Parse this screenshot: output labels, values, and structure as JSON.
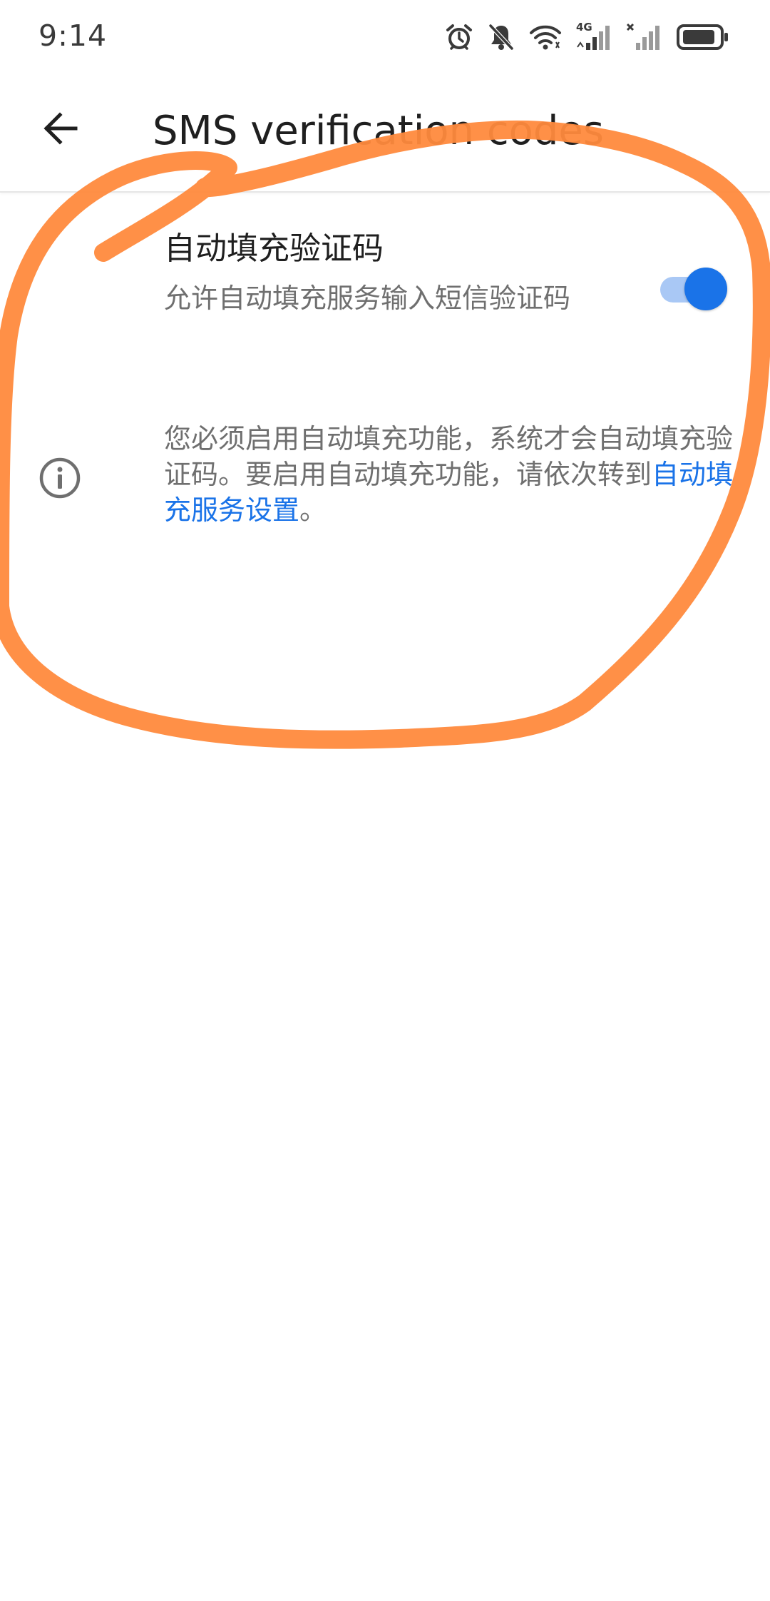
{
  "status_bar": {
    "time": "9:14",
    "network_label": "4G",
    "icons": [
      "alarm-icon",
      "bell-off-icon",
      "wifi-icon",
      "cellular-signal-icon",
      "no-sim-signal-icon",
      "battery-icon"
    ]
  },
  "app_bar": {
    "back_icon": "arrow-back-icon",
    "title": "SMS verification codes"
  },
  "switch_setting": {
    "title": "自动填充验证码",
    "summary": "允许自动填充服务输入短信验证码",
    "checked": true
  },
  "info": {
    "icon": "info-icon",
    "text_before_link": "您必须启用自动填充功能，系统才会自动填充验证码。要启用自动填充功能，请依次转到",
    "link_text": "自动填充服务设置",
    "text_after_link": "。"
  },
  "colors": {
    "accent": "#1a73e8",
    "toggle_track": "#a9c8f5",
    "annotation_stroke": "#ff8a3d",
    "secondary_text": "#6f6f6f",
    "primary_text": "#1f1f1f"
  }
}
